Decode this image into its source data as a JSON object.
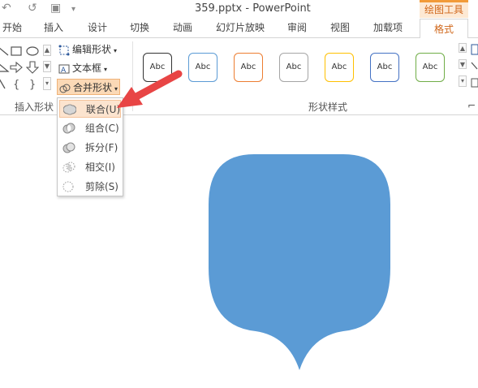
{
  "titlebar": {
    "quick_access": [
      "↶",
      "↺",
      "▣",
      "▾"
    ],
    "document_title": "359.pptx - PowerPoint",
    "context_tab": "绘图工具"
  },
  "tabs": [
    {
      "label": "开始"
    },
    {
      "label": "插入"
    },
    {
      "label": "设计"
    },
    {
      "label": "切换"
    },
    {
      "label": "动画"
    },
    {
      "label": "幻灯片放映"
    },
    {
      "label": "审阅"
    },
    {
      "label": "视图"
    },
    {
      "label": "加载项"
    },
    {
      "label": "格式",
      "active": true
    }
  ],
  "ribbon": {
    "insert_shapes": {
      "label": "插入形状",
      "edit_shape": "编辑形状",
      "text_box": "文本框",
      "merge_shapes": "合并形状"
    },
    "shape_styles": {
      "label": "形状样式",
      "presets": [
        {
          "text": "Abc",
          "border": "#333333"
        },
        {
          "text": "Abc",
          "border": "#5b9bd5"
        },
        {
          "text": "Abc",
          "border": "#ed7d31"
        },
        {
          "text": "Abc",
          "border": "#a5a5a5"
        },
        {
          "text": "Abc",
          "border": "#ffc000"
        },
        {
          "text": "Abc",
          "border": "#4472c4"
        },
        {
          "text": "Abc",
          "border": "#70ad47"
        }
      ]
    }
  },
  "merge_menu": {
    "items": [
      {
        "label": "联合(U)",
        "highlighted": true
      },
      {
        "label": "组合(C)"
      },
      {
        "label": "拆分(F)"
      },
      {
        "label": "相交(I)"
      },
      {
        "label": "剪除(S)"
      }
    ]
  },
  "slide": {
    "shape_fill": "#5b9bd5",
    "arrow_color": "#e84545"
  }
}
